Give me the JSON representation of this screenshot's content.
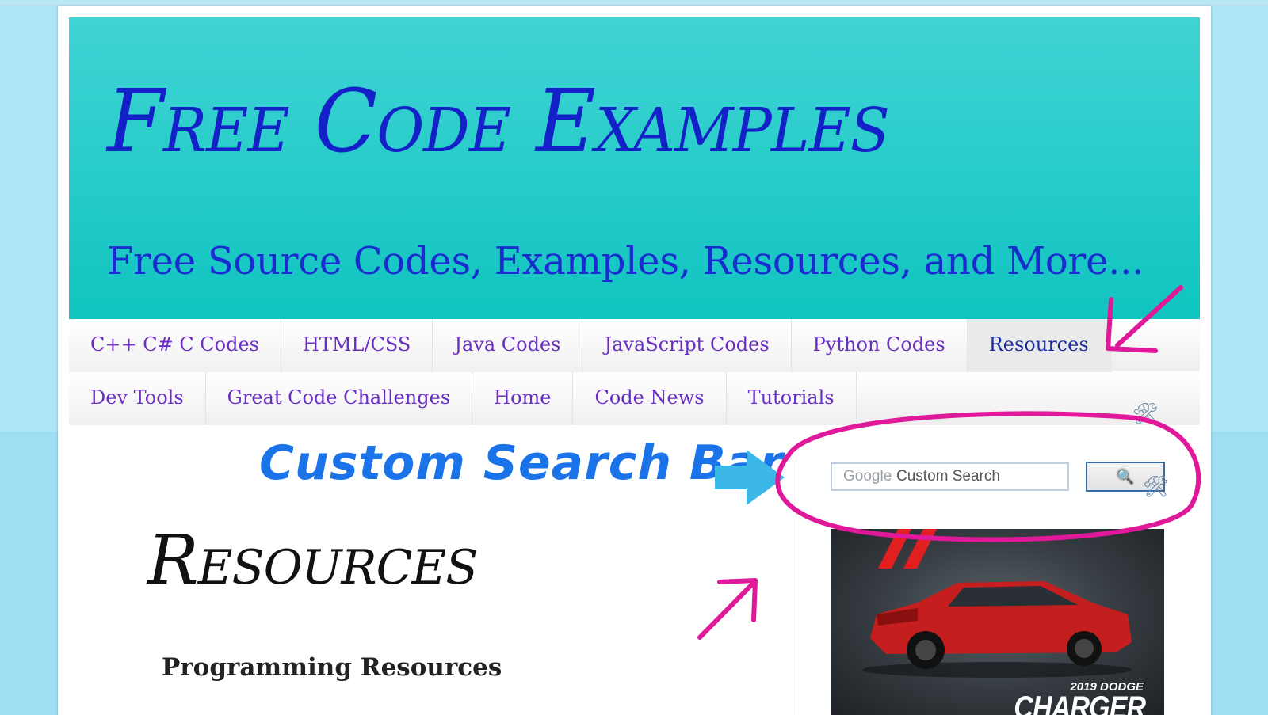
{
  "header": {
    "title": "Free Code Examples",
    "description": "Free Source Codes, Examples, Resources, and More..."
  },
  "nav": {
    "row1": [
      "C++ C# C Codes",
      "HTML/CSS",
      "Java Codes",
      "JavaScript Codes",
      "Python Codes",
      "Resources"
    ],
    "row2": [
      "Dev Tools",
      "Great Code Challenges",
      "Home",
      "Code News",
      "Tutorials"
    ],
    "active": "Resources"
  },
  "annotation": {
    "text": "Custom Search Bar"
  },
  "search": {
    "brand": "Google",
    "placeholder": "Custom Search",
    "button_icon": "search-icon"
  },
  "ad": {
    "year": "2019 DODGE",
    "model": "CHARGER"
  },
  "main": {
    "heading": "Resources",
    "subheading": "Programming Resources"
  },
  "colors": {
    "header_top": "#40d4d4",
    "header_bottom": "#10c4c0",
    "title": "#1420c8",
    "nav_link": "#6a2fc0",
    "annotation_blue": "#1a73e8",
    "annotation_magenta": "#e0189a"
  }
}
